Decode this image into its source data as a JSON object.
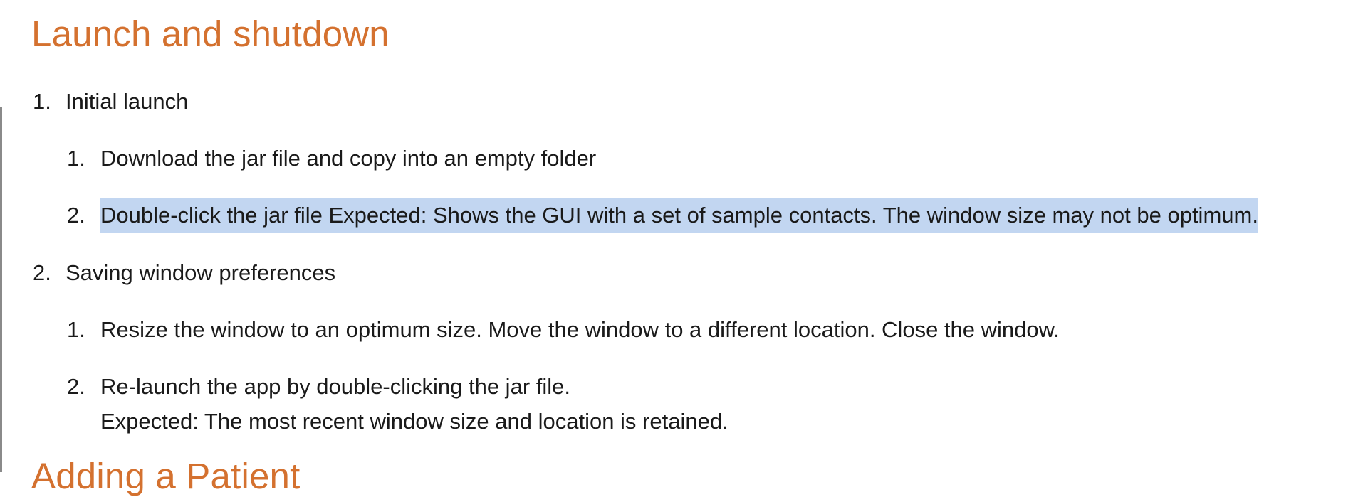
{
  "heading": "Launch and shutdown",
  "next_heading": "Adding a Patient",
  "sections": [
    {
      "number": "1.",
      "title": "Initial launch",
      "steps": [
        {
          "number": "1.",
          "text": "Download the jar file and copy into an empty folder"
        },
        {
          "number": "2.",
          "text": "Double-click the jar file Expected: Shows the GUI with a set of sample contacts. The window size may not be optimum.",
          "highlighted": true
        }
      ]
    },
    {
      "number": "2.",
      "title": "Saving window preferences",
      "steps": [
        {
          "number": "1.",
          "text": "Resize the window to an optimum size. Move the window to a different location. Close the window."
        },
        {
          "number": "2.",
          "text": "Re-launch the app by double-clicking the jar file.",
          "expected": "Expected: The most recent window size and location is retained."
        }
      ]
    }
  ]
}
